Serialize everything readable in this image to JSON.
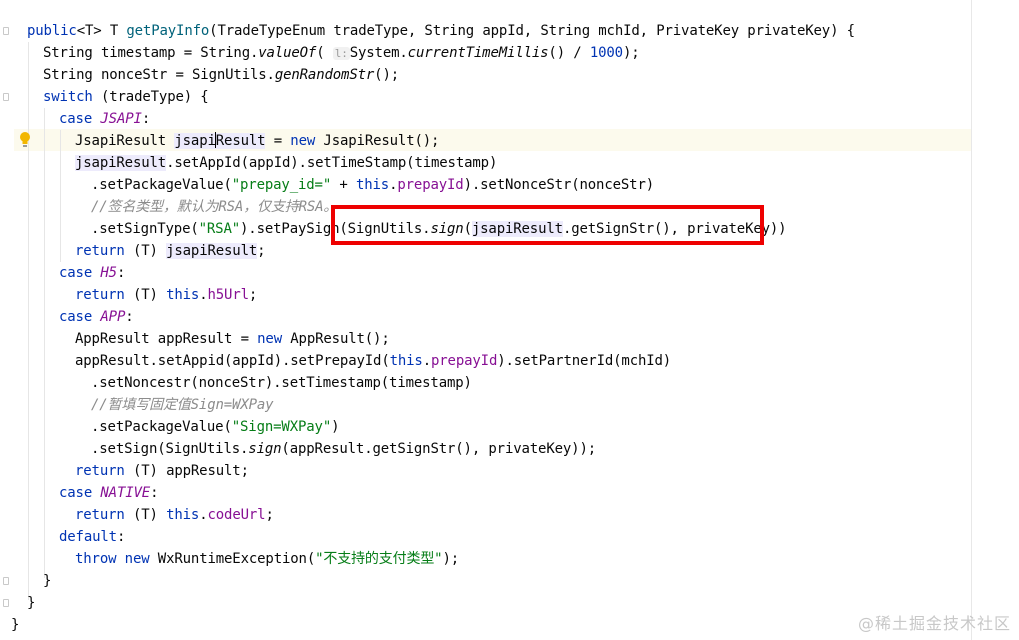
{
  "editor": {
    "lines": [
      {
        "segs": [
          [
            "kw",
            "public"
          ],
          [
            "",
            "<"
          ],
          [
            "",
            "T"
          ],
          [
            "",
            "> "
          ],
          [
            "",
            "T "
          ],
          [
            "mth",
            "getPayInfo"
          ],
          [
            "",
            "(TradeTypeEnum tradeType, String appId, String mchId, PrivateKey privateKey) {"
          ]
        ]
      },
      {
        "segs": [
          [
            "",
            "String timestamp = String."
          ],
          [
            "ital",
            "valueOf"
          ],
          [
            "",
            "( "
          ],
          [
            "hint",
            "l:"
          ],
          [
            "",
            ""
          ],
          [
            "",
            "System."
          ],
          [
            "ital",
            "currentTimeMillis"
          ],
          [
            "",
            "() / "
          ],
          [
            "kw",
            "1000"
          ],
          [
            "",
            ");"
          ]
        ]
      },
      {
        "segs": [
          [
            "",
            "String nonceStr = SignUtils."
          ],
          [
            "ital",
            "genRandomStr"
          ],
          [
            "",
            "();"
          ]
        ]
      },
      {
        "segs": [
          [
            "kw",
            "switch"
          ],
          [
            "",
            " (tradeType) {"
          ]
        ]
      },
      {
        "segs": [
          [
            "kw",
            "case "
          ],
          [
            "enum",
            "JSAPI"
          ],
          [
            "",
            ":"
          ]
        ]
      },
      {
        "segs": [
          [
            "",
            "JsapiResult "
          ],
          [
            "usage",
            "jsapi"
          ],
          [
            "caret",
            ""
          ],
          [
            "usage",
            "Result"
          ],
          [
            "",
            " = "
          ],
          [
            "kw",
            "new "
          ],
          [
            "",
            "JsapiResult();"
          ]
        ]
      },
      {
        "segs": [
          [
            "usage",
            "jsapiResult"
          ],
          [
            "",
            ".setAppId(appId).setTimeStamp(timestamp)"
          ]
        ]
      },
      {
        "segs": [
          [
            "",
            ".setPackageValue("
          ],
          [
            "str",
            "\"prepay_id=\""
          ],
          [
            "",
            " + "
          ],
          [
            "kw",
            "this"
          ],
          [
            "",
            "."
          ],
          [
            "fld",
            "prepayId"
          ],
          [
            "",
            ").setNonceStr(nonceStr)"
          ]
        ]
      },
      {
        "segs": [
          [
            "cmt",
            "//签名类型，默认为RSA，仅支持RSA。"
          ]
        ]
      },
      {
        "segs": [
          [
            "",
            ".setSignType("
          ],
          [
            "str",
            "\"RSA\""
          ],
          [
            "",
            ").setPaySign(SignUtils."
          ],
          [
            "ital",
            "sign"
          ],
          [
            "",
            "("
          ],
          [
            "usage",
            "jsapiResult"
          ],
          [
            "",
            ".getSignStr(), privateKey))"
          ]
        ]
      },
      {
        "segs": [
          [
            "kw",
            "return "
          ],
          [
            "",
            "(T) "
          ],
          [
            "usage",
            "jsapiResult"
          ],
          [
            "",
            ";"
          ]
        ]
      },
      {
        "segs": [
          [
            "kw",
            "case "
          ],
          [
            "enum",
            "H5"
          ],
          [
            "",
            ":"
          ]
        ]
      },
      {
        "segs": [
          [
            "kw",
            "return "
          ],
          [
            "",
            "(T) "
          ],
          [
            "kw",
            "this"
          ],
          [
            "",
            "."
          ],
          [
            "fld",
            "h5Url"
          ],
          [
            "",
            ";"
          ]
        ]
      },
      {
        "segs": [
          [
            "kw",
            "case "
          ],
          [
            "enum",
            "APP"
          ],
          [
            "",
            ":"
          ]
        ]
      },
      {
        "segs": [
          [
            "",
            "AppResult appResult = "
          ],
          [
            "kw",
            "new "
          ],
          [
            "",
            "AppResult();"
          ]
        ]
      },
      {
        "segs": [
          [
            "",
            "appResult.setAppid(appId).setPrepayId("
          ],
          [
            "kw",
            "this"
          ],
          [
            "",
            "."
          ],
          [
            "fld",
            "prepayId"
          ],
          [
            "",
            ").setPartnerId(mchId)"
          ]
        ]
      },
      {
        "segs": [
          [
            "",
            ".setNoncestr(nonceStr).setTimestamp(timestamp)"
          ]
        ]
      },
      {
        "segs": [
          [
            "cmt",
            "//暂填写固定值Sign=WXPay"
          ]
        ]
      },
      {
        "segs": [
          [
            "",
            ".setPackageValue("
          ],
          [
            "str",
            "\"Sign=WXPay\""
          ],
          [
            "",
            ")"
          ]
        ]
      },
      {
        "segs": [
          [
            "",
            ".setSign(SignUtils."
          ],
          [
            "ital",
            "sign"
          ],
          [
            "",
            "(appResult.getSignStr(), privateKey));"
          ]
        ]
      },
      {
        "segs": [
          [
            "kw",
            "return "
          ],
          [
            "",
            "(T) appResult;"
          ]
        ]
      },
      {
        "segs": [
          [
            "kw",
            "case "
          ],
          [
            "enum",
            "NATIVE"
          ],
          [
            "",
            ":"
          ]
        ]
      },
      {
        "segs": [
          [
            "kw",
            "return "
          ],
          [
            "",
            "(T) "
          ],
          [
            "kw",
            "this"
          ],
          [
            "",
            "."
          ],
          [
            "fld",
            "codeUrl"
          ],
          [
            "",
            ";"
          ]
        ]
      },
      {
        "segs": [
          [
            "kw",
            "default"
          ],
          [
            "",
            ":"
          ]
        ]
      },
      {
        "segs": [
          [
            "kw",
            "throw new "
          ],
          [
            "",
            "WxRuntimeException("
          ],
          [
            "str",
            "\"不支持的支付类型\""
          ],
          [
            "",
            ");"
          ]
        ]
      },
      {
        "segs": [
          [
            "",
            "}"
          ]
        ]
      },
      {
        "segs": [
          [
            "",
            "}"
          ]
        ]
      },
      {
        "segs": [
          [
            "",
            "}"
          ]
        ]
      }
    ]
  },
  "watermark": "@稀土掘金技术社区",
  "colors": {
    "highlight_box": "#ee0000",
    "keyword": "#0033b3",
    "string": "#067d17",
    "field": "#871094",
    "comment": "#8c8c8c"
  },
  "icons": {
    "intention_bulb": "lightbulb-icon"
  }
}
